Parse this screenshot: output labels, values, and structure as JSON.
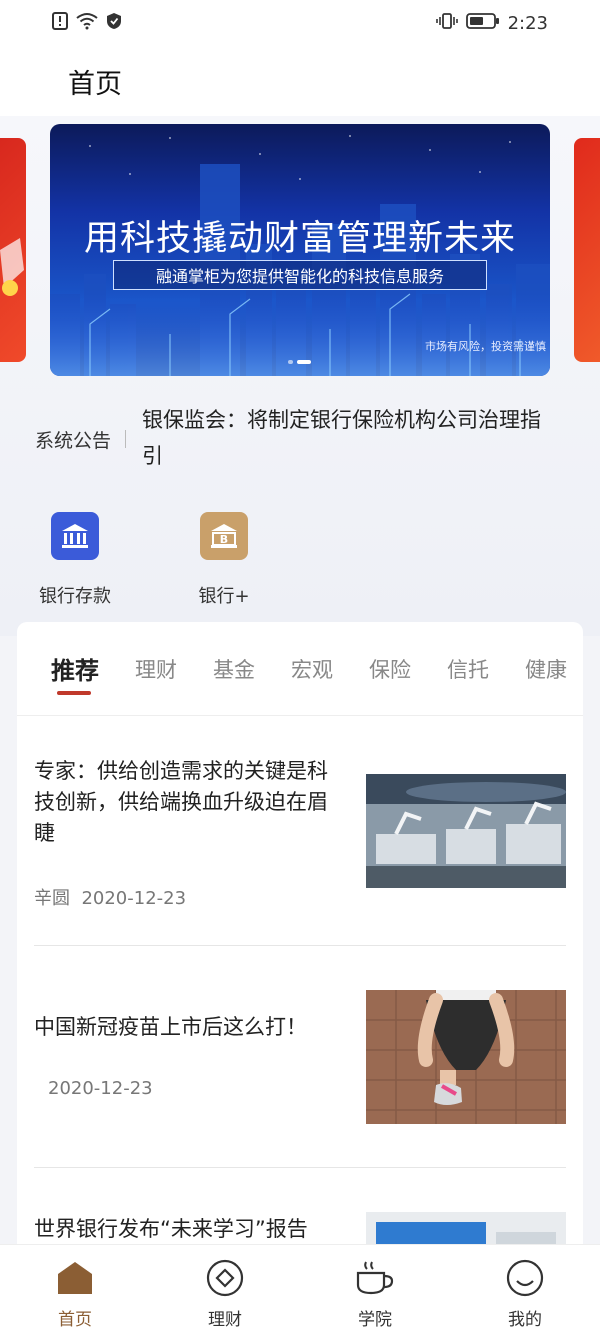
{
  "status_bar": {
    "time": "2:23"
  },
  "header": {
    "title": "首页"
  },
  "banner": {
    "title": "用科技撬动财富管理新未来",
    "subtitle": "融通掌柜为您提供智能化的科技信息服务",
    "risk_notice": "市场有风险，投资需谨慎"
  },
  "notice": {
    "label": "系统公告",
    "text": "银保监会：将制定银行保险机构公司治理指引"
  },
  "quick_actions": [
    {
      "label": "银行存款",
      "icon": "bank-icon",
      "color": "#3b5bd9"
    },
    {
      "label": "银行+",
      "icon": "bank-plus-icon",
      "color": "#c9a06a"
    }
  ],
  "tabs": [
    "推荐",
    "理财",
    "基金",
    "宏观",
    "保险",
    "信托",
    "健康"
  ],
  "articles": [
    {
      "title": "专家：供给创造需求的关键是科技创新，供给端换血升级迫在眉睫",
      "author": "辛圆",
      "date": "2020-12-23",
      "thumb": "factory-robots-image"
    },
    {
      "title": "中国新冠疫苗上市后这么打！",
      "author": "",
      "date": "2020-12-23",
      "thumb": "tying-shoes-image"
    },
    {
      "title": "世界银行发布“未来学习”报告",
      "author": "",
      "date": "",
      "thumb": "blue-object-image"
    }
  ],
  "tabbar": [
    {
      "label": "首页",
      "icon": "home-icon",
      "active": true
    },
    {
      "label": "理财",
      "icon": "finance-icon",
      "active": false
    },
    {
      "label": "学院",
      "icon": "coffee-cup-icon",
      "active": false
    },
    {
      "label": "我的",
      "icon": "smiley-user-icon",
      "active": false
    }
  ],
  "colors": {
    "accent": "#c0392b",
    "active_tab": "#8b5e34"
  }
}
